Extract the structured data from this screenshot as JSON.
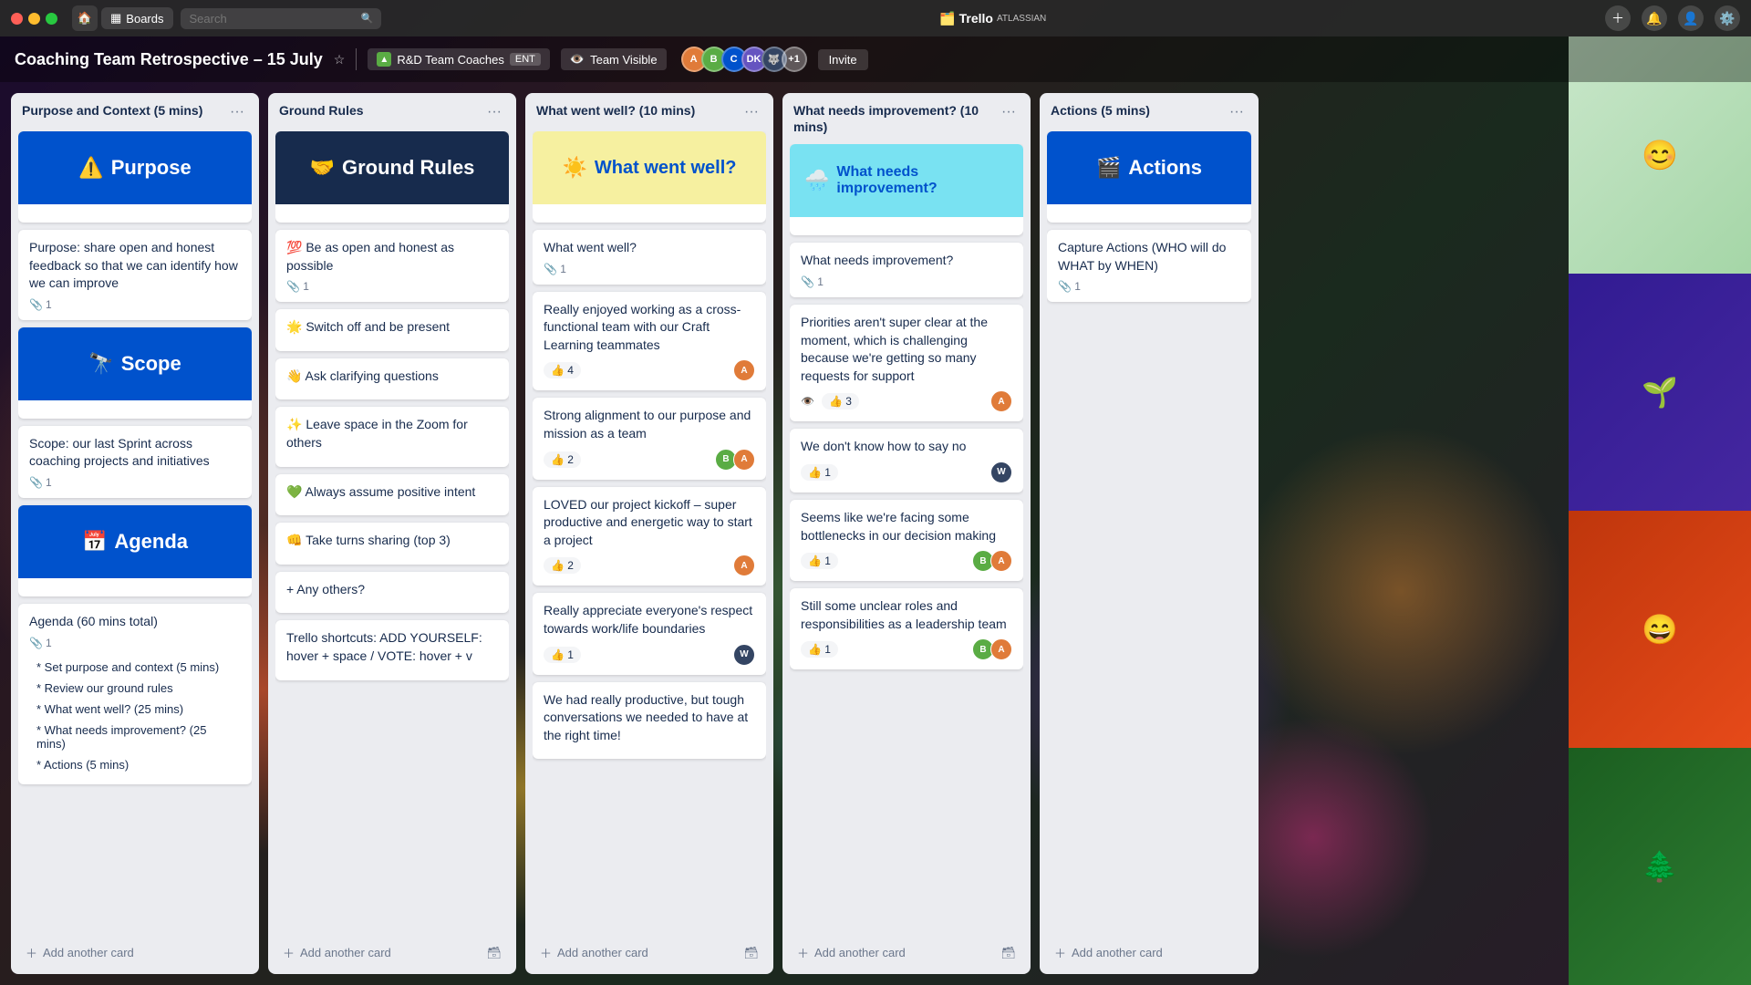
{
  "app": {
    "name": "Trello",
    "subtitle": "ATLASSIAN"
  },
  "titlebar": {
    "nav_home": "🏠",
    "boards_label": "Boards",
    "search_placeholder": "Search"
  },
  "board": {
    "title": "Coaching Team Retrospective – 15 July",
    "team_label": "R&D Team Coaches",
    "team_ent": "ENT",
    "visibility_label": "Team Visible",
    "invite_label": "Invite",
    "plus_one": "+1"
  },
  "columns": [
    {
      "id": "purpose",
      "title": "Purpose and Context (5 mins)",
      "cards": [
        {
          "id": "p1",
          "cover_emoji": "⚠️",
          "cover_text": "Purpose",
          "cover_style": "cover-blue",
          "body": "Purpose: share open and honest feedback so that we can identify how we can improve",
          "attachments": 1
        },
        {
          "id": "p2",
          "cover_emoji": "🔭",
          "cover_text": "Scope",
          "cover_style": "cover-blue",
          "body": "Scope: our last Sprint across coaching projects and initiatives",
          "attachments": 1
        },
        {
          "id": "p3",
          "cover_emoji": "📅",
          "cover_text": "Agenda",
          "cover_style": "cover-blue",
          "body": "Agenda (60 mins total)",
          "attachments": 1,
          "list_items": [
            "* Set purpose and context (5 mins)",
            "* Review our ground rules",
            "* What went well? (25 mins)",
            "* What needs improvement? (25 mins)",
            "* Actions (5 mins)"
          ]
        }
      ],
      "add_label": "+ Add another card"
    },
    {
      "id": "ground-rules",
      "title": "Ground Rules",
      "cards": [
        {
          "id": "gr0",
          "cover_emoji": "🤝",
          "cover_text": "Ground Rules",
          "cover_style": "cover-dark"
        },
        {
          "id": "gr1",
          "emoji": "💯",
          "title": "Be as open and honest as possible",
          "attachments": 1
        },
        {
          "id": "gr2",
          "emoji": "🌟",
          "title": "Switch off and be present"
        },
        {
          "id": "gr3",
          "emoji": "👋",
          "title": "Ask clarifying questions"
        },
        {
          "id": "gr4",
          "emoji": "✨",
          "title": "Leave space in the Zoom for others"
        },
        {
          "id": "gr5",
          "emoji": "💚",
          "title": "Always assume positive intent"
        },
        {
          "id": "gr6",
          "emoji": "👊",
          "title": "Take turns sharing (top 3)"
        },
        {
          "id": "gr7",
          "title": "+ Any others?"
        },
        {
          "id": "gr8",
          "title": "Trello shortcuts: ADD YOURSELF: hover + space / VOTE: hover + v"
        }
      ],
      "add_label": "+ Add another card"
    },
    {
      "id": "went-well",
      "title": "What went well? (10 mins)",
      "cards": [
        {
          "id": "ww0",
          "cover_emoji": "☀️",
          "cover_text": "What went well?",
          "cover_style": "cover-yellow"
        },
        {
          "id": "ww1",
          "title": "What went well?",
          "attachments": 1
        },
        {
          "id": "ww2",
          "title": "Really enjoyed working as a cross-functional team with our Craft Learning teammates",
          "likes": 4,
          "avatar_colors": [
            "#e07b39"
          ]
        },
        {
          "id": "ww3",
          "title": "Strong alignment to our purpose and mission as a team",
          "likes": 2,
          "avatar_colors": [
            "#5aac44",
            "#e07b39"
          ]
        },
        {
          "id": "ww4",
          "title": "LOVED our project kickoff – super productive and energetic way to start a project",
          "likes": 2,
          "avatar_colors": [
            "#e07b39"
          ]
        },
        {
          "id": "ww5",
          "title": "Really appreciate everyone's respect towards work/life boundaries",
          "likes": 1,
          "avatar_colors": [
            "#344563"
          ]
        },
        {
          "id": "ww6",
          "title": "We had really productive, but tough conversations we needed to have at the right time!"
        }
      ],
      "add_label": "+ Add another card"
    },
    {
      "id": "needs-improvement",
      "title": "What needs improvement? (10 mins)",
      "cards": [
        {
          "id": "ni0",
          "cover_emoji": "🌧️",
          "cover_text": "What needs improvement?",
          "cover_style": "cover-teal"
        },
        {
          "id": "ni1",
          "title": "What needs improvement?",
          "attachments": 1
        },
        {
          "id": "ni2",
          "title": "Priorities aren't super clear at the moment, which is challenging because we're getting so many requests for support",
          "eyes": true,
          "likes": 3,
          "avatar_colors": [
            "#e07b39"
          ]
        },
        {
          "id": "ni3",
          "title": "We don't know how to say no",
          "likes": 1,
          "avatar_colors": [
            "#344563"
          ]
        },
        {
          "id": "ni4",
          "title": "Seems like we're facing some bottlenecks in our decision making",
          "likes": 1,
          "avatar_colors": [
            "#5aac44",
            "#e07b39"
          ]
        },
        {
          "id": "ni5",
          "title": "Still some unclear roles and responsibilities as a leadership team",
          "likes": 1,
          "avatar_colors": [
            "#5aac44",
            "#e07b39"
          ]
        }
      ],
      "add_label": "+ Add another card"
    },
    {
      "id": "actions",
      "title": "Actions (5 mins)",
      "cards": [
        {
          "id": "a0",
          "cover_emoji": "🎬",
          "cover_text": "Actions",
          "cover_style": "cover-blue"
        },
        {
          "id": "a1",
          "title": "Capture Actions (WHO will do WHAT by WHEN)",
          "attachments": 1
        }
      ],
      "add_label": "+ Add another card"
    }
  ],
  "video_participants": [
    {
      "id": "v1",
      "emoji": "😊",
      "style": "participant-1"
    },
    {
      "id": "v2",
      "emoji": "🌱",
      "style": "participant-2"
    },
    {
      "id": "v3",
      "emoji": "😄",
      "style": "participant-3"
    },
    {
      "id": "v4",
      "emoji": "🌲",
      "style": "participant-4"
    }
  ]
}
